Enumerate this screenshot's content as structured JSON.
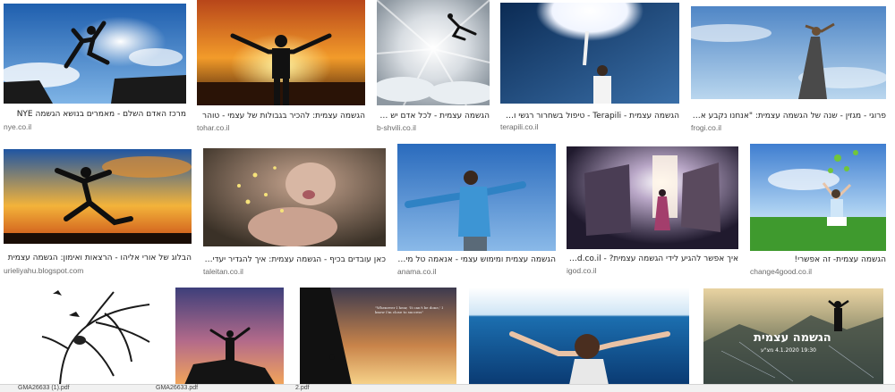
{
  "row1": [
    {
      "caption": "מרכז האדם השלם - מאמרים בנושא הגשמה NYE",
      "domain": "nye.co.il",
      "thumb": "man-jumping-between-cliffs"
    },
    {
      "caption": "הגשמה עצמית: להכיר בגבולות של עצמי - טוהר",
      "domain": "tohar.co.il",
      "thumb": "silhouette-arms-raised-sunset"
    },
    {
      "caption": "הגשמה עצמית - לכל אדם יש שביל ... - Shvili",
      "domain": "b-shvili.co.il",
      "thumb": "figure-leaping-into-light"
    },
    {
      "caption": "הגשמה עצמית - Terapili - טיפול בשחרור רגשי ומדיטציה |",
      "domain": "terapili.co.il",
      "thumb": "man-touching-moon"
    },
    {
      "caption": "פרוגי - מגזין - שנה של הגשמה עצמית: \"אנחנו נקבע אם נצליח או ...",
      "domain": "frogi.co.il",
      "thumb": "woman-wind-sky"
    }
  ],
  "row2": [
    {
      "caption": "הבלוג של אורי אליהו - הרצאות ואימון: הגשמה עצמית",
      "domain": "urieliyahu.blogspot.com",
      "thumb": "runner-silhouette-sunset"
    },
    {
      "caption": "כאן עובדים בכיף - הגשמה עצמית: איך להגדיר יעדים אישיים ...",
      "domain": "taleitan.co.il",
      "thumb": "woman-blowing-sparkles"
    },
    {
      "caption": "הגשמה עצמית ומימוש עצמי - אנאמה טל מילר העצ...",
      "domain": "anama.co.il",
      "thumb": "man-arms-open-blue-sky"
    },
    {
      "caption": "איך אפשר להגיע לידי הגשמה עצמית? - iGod.co.il",
      "domain": "igod.co.il",
      "thumb": "woman-facing-glowing-door"
    },
    {
      "caption": "הגשמה עצמית- זה אפשרי!",
      "domain": "change4good.co.il",
      "thumb": "woman-arms-raised-field"
    }
  ],
  "row3": [
    {
      "thumb": "tree-face-birds-drawing"
    },
    {
      "thumb": "man-on-rock-sunset"
    },
    {
      "thumb": "climber-cliff-quote",
      "quote": "\"Whenever I hear, 'It can't be done,' I know I'm close to success\""
    },
    {
      "thumb": "woman-arms-open-sea"
    },
    {
      "thumb": "mountain-man-poster",
      "poster_title": "הגשמה עצמית",
      "poster_sub": "19:30 4.1.2020 מצ\"ע"
    }
  ],
  "downloads": [
    "GMA26633 (1).pdf",
    "GMA26633.pdf",
    "2.pdf"
  ]
}
